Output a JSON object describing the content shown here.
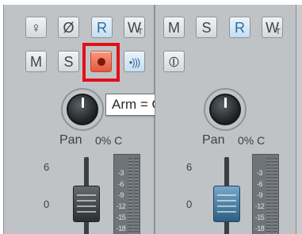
{
  "strip_left": {
    "row1": {
      "input_label": "♀",
      "phase_label": "Ø",
      "read_label": "R",
      "write_label": "W",
      "write_sub": "T"
    },
    "row2": {
      "mute_label": "M",
      "solo_label": "S",
      "arm_state": "on",
      "monitor_label": "•)))"
    },
    "tooltip": "Arm = On",
    "pan": {
      "label": "Pan",
      "value": "0% C"
    },
    "scale": [
      "6",
      "0"
    ],
    "meter_scale": [
      "-3",
      "-6",
      "-9",
      "-12",
      "-15",
      "-18"
    ]
  },
  "strip_right": {
    "row1": {
      "mute_label": "M",
      "solo_label": "S",
      "read_label": "R",
      "write_label": "W",
      "write_sub": "T"
    },
    "row2": {
      "stereo_label": "⦶"
    },
    "pan": {
      "label": "Pan",
      "value": "0% C"
    },
    "scale": [
      "6",
      "0"
    ],
    "meter_scale": [
      "-3",
      "-6",
      "-9",
      "-12",
      "-15",
      "-18"
    ]
  },
  "colors": {
    "arm_on": "#e4583d",
    "highlight": "#e0101a",
    "read_active": "#2f6aa0",
    "fader_cap_selected": "#2c5f84"
  }
}
